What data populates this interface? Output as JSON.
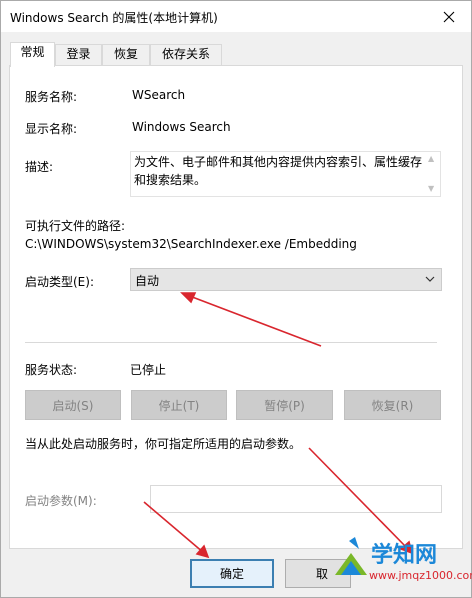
{
  "window": {
    "title": "Windows Search 的属性(本地计算机)"
  },
  "tabs": [
    {
      "label": "常规"
    },
    {
      "label": "登录"
    },
    {
      "label": "恢复"
    },
    {
      "label": "依存关系"
    }
  ],
  "general": {
    "service_name_label": "服务名称:",
    "service_name_value": "WSearch",
    "display_name_label": "显示名称:",
    "display_name_value": "Windows Search",
    "description_label": "描述:",
    "description_value": "为文件、电子邮件和其他内容提供内容索引、属性缓存和搜索结果。",
    "path_label": "可执行文件的路径:",
    "path_value": "C:\\WINDOWS\\system32\\SearchIndexer.exe /Embedding",
    "startup_type_label": "启动类型(E):",
    "startup_type_value": "自动",
    "status_label": "服务状态:",
    "status_value": "已停止",
    "buttons": {
      "start": "启动(S)",
      "stop": "停止(T)",
      "pause": "暂停(P)",
      "resume": "恢复(R)"
    },
    "hint": "当从此处启动服务时，你可指定所适用的启动参数。",
    "params_label": "启动参数(M):"
  },
  "footer": {
    "ok": "确定",
    "cancel_partial": "取"
  },
  "watermark": {
    "brand": "学知网",
    "url": "www.jmqz1000.com"
  },
  "colors": {
    "arrow": "#d9262e",
    "default_button_border": "#3c7fb1",
    "logo_green": "#7ab829",
    "logo_blue": "#1c88d8"
  }
}
